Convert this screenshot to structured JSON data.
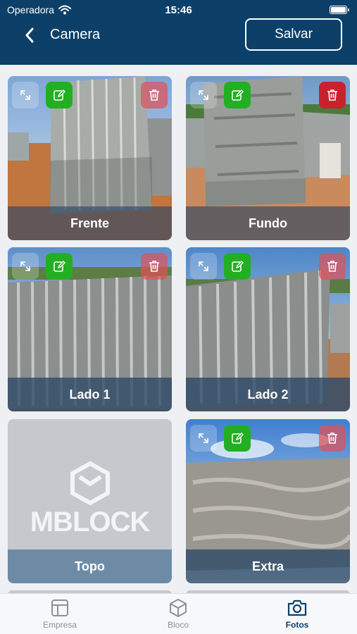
{
  "status": {
    "carrier": "Operadora",
    "time": "15:46"
  },
  "header": {
    "title": "Camera",
    "save_label": "Salvar"
  },
  "photos": [
    {
      "label": "Frente"
    },
    {
      "label": "Fundo"
    },
    {
      "label": "Lado 1"
    },
    {
      "label": "Lado 2"
    },
    {
      "label": "Topo",
      "placeholder_logo": "MBLOCK"
    },
    {
      "label": "Extra"
    }
  ],
  "tabs": [
    {
      "label": "Empresa",
      "icon": "layout-icon"
    },
    {
      "label": "Bloco",
      "icon": "cube-icon"
    },
    {
      "label": "Fotos",
      "icon": "camera-icon",
      "active": true
    }
  ],
  "colors": {
    "header": "#0c4069",
    "edit": "#22b022",
    "delete": "#e25055"
  }
}
